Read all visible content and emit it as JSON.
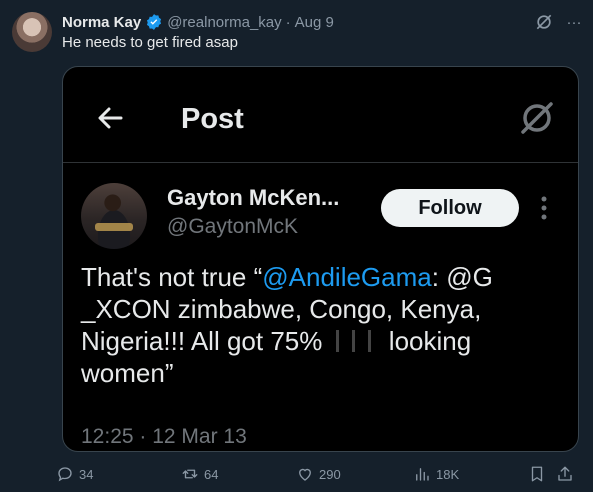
{
  "tweet": {
    "author_name": "Norma Kay",
    "author_handle": "@realnorma_kay",
    "separator": "·",
    "date": "Aug 9",
    "text": "He needs to get fired asap",
    "more_label": "···"
  },
  "embedded": {
    "title": "Post",
    "author_name": "Gayton McKen...",
    "author_handle": "@GaytonMcK",
    "follow_label": "Follow",
    "body_part1": "That's not true “",
    "mention1": "@AndileGama",
    "body_part2": ": @G _XCON zimbabwe, Congo, Kenya, Nigeria!!! All got 75% ",
    "body_part3": " looking women”",
    "timestamp": "12:25 · 12 Mar 13"
  },
  "actions": {
    "replies": "34",
    "reposts": "64",
    "likes": "290",
    "views": "18K"
  },
  "colors": {
    "background": "#15202b",
    "mention": "#1d9bf0",
    "muted": "#8b98a5",
    "verified": "#1d9bf0"
  }
}
